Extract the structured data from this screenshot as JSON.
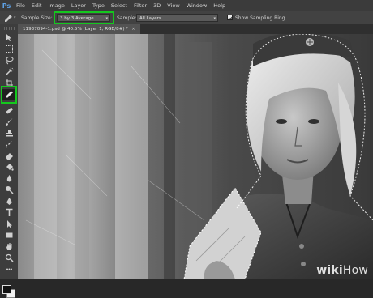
{
  "app": {
    "logo": "Ps"
  },
  "menu": {
    "items": [
      "File",
      "Edit",
      "Image",
      "Layer",
      "Type",
      "Select",
      "Filter",
      "3D",
      "View",
      "Window",
      "Help"
    ]
  },
  "options": {
    "sample_size_label": "Sample Size:",
    "sample_size_value": "3 by 3 Average",
    "sample_label": "Sample:",
    "sample_value": "All Layers",
    "show_sampling_ring_label": "Show Sampling Ring",
    "show_sampling_ring_checked": true,
    "highlight_color": "#14c81e"
  },
  "document": {
    "tab_title": "11937094-1.psd @ 40.5% (Layer 1, RGB/8#) *",
    "close_glyph": "×"
  },
  "tools": [
    "move-tool",
    "marquee-tool",
    "lasso-tool",
    "quick-selection-tool",
    "eyedropper-tool",
    "spot-healing-tool",
    "brush-tool",
    "clone-stamp-tool",
    "history-brush-tool",
    "eraser-tool",
    "gradient-tool",
    "blur-tool",
    "dodge-tool",
    "pen-tool",
    "type-tool",
    "path-selection-tool",
    "rectangle-tool",
    "hand-tool",
    "zoom-tool"
  ],
  "secondary_tools": [
    "eyedropper-tool",
    "text-tool",
    "3d-rotate-tool",
    "info-tool",
    "color-tool"
  ],
  "active_tool": "eyedropper-tool",
  "watermark": {
    "brand": "wiki",
    "suffix": "How"
  }
}
